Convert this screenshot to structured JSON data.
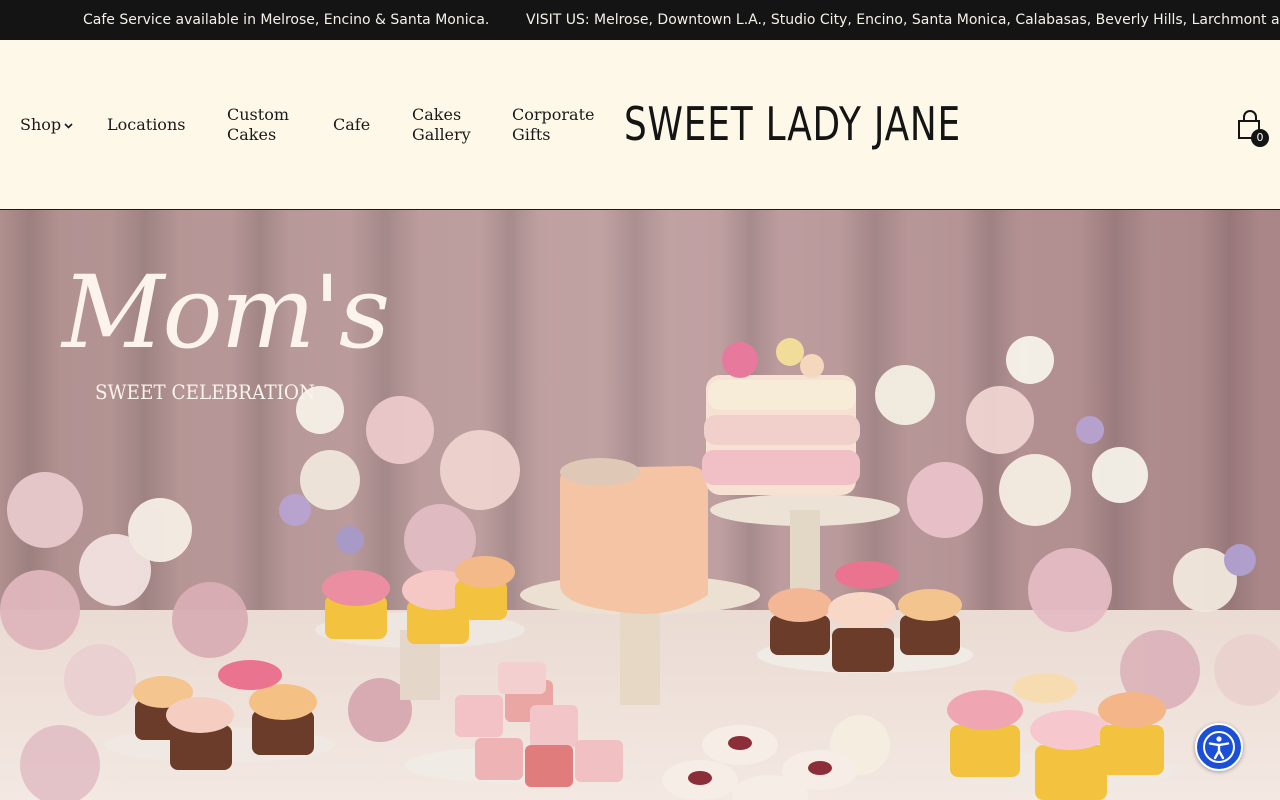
{
  "announcement": {
    "left": "Cafe Service available in Melrose, Encino & Santa Monica.",
    "right": "VISIT US: Melrose, Downtown L.A., Studio City, Encino, Santa Monica, Calabasas, Beverly Hills, Larchmont and Sa"
  },
  "nav": {
    "shop": "Shop",
    "locations": "Locations",
    "custom_cakes": "Custom Cakes",
    "cafe": "Cafe",
    "cakes_gallery": "Cakes Gallery",
    "corporate_gifts": "Corporate Gifts"
  },
  "brand": {
    "logo_text": "SWEET LADY JANE"
  },
  "cart": {
    "count": "0",
    "icon": "shopping-bag-icon"
  },
  "hero": {
    "title": "Mom's",
    "subtitle": "SWEET CELEBRATION"
  },
  "accessibility": {
    "icon": "accessibility-icon",
    "color": "#1b4fd6"
  },
  "colors": {
    "header_bg": "#fdf8e8",
    "announce_bg": "#141414",
    "curtain": "#b89a9c"
  }
}
